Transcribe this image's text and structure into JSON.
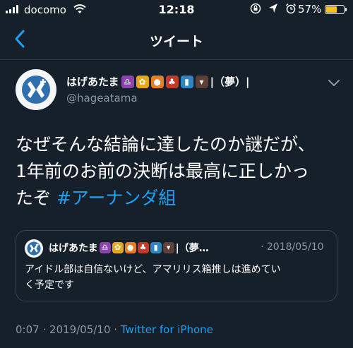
{
  "status_bar": {
    "carrier": "docomo",
    "time": "12:18",
    "battery_percent": "57%",
    "battery_level": 0.57,
    "icons": [
      "rotation-lock-icon",
      "location-icon",
      "alarm-icon"
    ]
  },
  "nav": {
    "title": "ツイート",
    "back_icon": "chevron-left-icon"
  },
  "tweet": {
    "display_name": "はげあたま",
    "name_suffix": "|（夢）|",
    "emoji": [
      "libra-icon",
      "sunflower-icon",
      "lion-icon",
      "cherries-icon",
      "signal-bars-icon",
      "bat-icon"
    ],
    "handle": "@hageatama",
    "text_line1": "なぜそんな結論に達したのか謎だが、",
    "text_line2": "1年前のお前の決断は最高に正しかっ",
    "text_line3": "たぞ ",
    "hashtag": "#アーナンダ組",
    "time": "0:07",
    "separator": "·",
    "date": "2019/05/10",
    "source": "Twitter for iPhone"
  },
  "quoted": {
    "display_name": "はげあたま",
    "name_suffix": "|（夢…",
    "date": "· 2018/05/10",
    "text_line1": "アイドル部は自信ないけど、アマリリス箱推しは進めてい",
    "text_line2": "く予定です"
  },
  "colors": {
    "background": "#15202b",
    "accent": "#1da1f2",
    "muted": "#8899a6",
    "border": "#38444d"
  }
}
